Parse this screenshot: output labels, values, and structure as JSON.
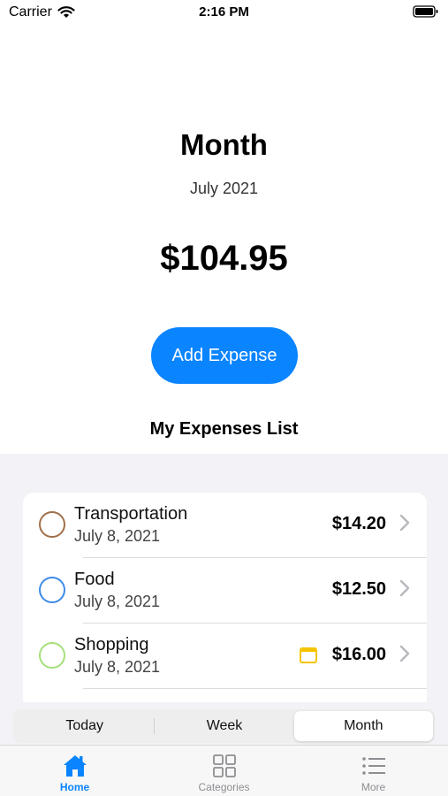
{
  "status_bar": {
    "carrier": "Carrier",
    "time": "2:16 PM"
  },
  "header": {
    "title": "Month",
    "period": "July 2021",
    "total": "$104.95"
  },
  "add_button": {
    "label": "Add Expense"
  },
  "list": {
    "title": "My Expenses List",
    "items": [
      {
        "name": "Transportation",
        "date": "July 8, 2021",
        "amount": "$14.20",
        "color": "#a0704a"
      },
      {
        "name": "Food",
        "date": "July 8, 2021",
        "amount": "$12.50",
        "color": "#3d8be8"
      },
      {
        "name": "Shopping",
        "date": "July 8, 2021",
        "amount": "$16.00",
        "color": "#a6e07a",
        "icon": "calendar-icon"
      }
    ]
  },
  "segmented": {
    "options": [
      "Today",
      "Week",
      "Month"
    ],
    "selected": "Month"
  },
  "tabbar": {
    "tabs": [
      {
        "label": "Home",
        "icon": "house-icon",
        "active": true
      },
      {
        "label": "Categories",
        "icon": "grid-icon",
        "active": false
      },
      {
        "label": "More",
        "icon": "list-icon",
        "active": false
      }
    ]
  },
  "colors": {
    "accent": "#0a84ff",
    "background": "#f2f2f7"
  }
}
